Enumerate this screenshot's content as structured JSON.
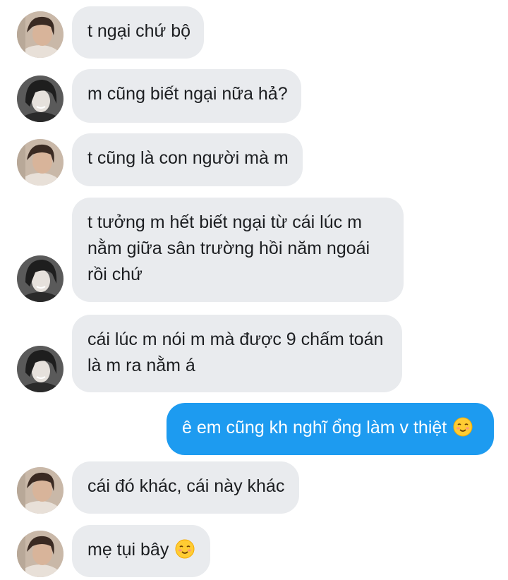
{
  "colors": {
    "received_bubble": "#e9ebee",
    "sent_bubble": "#1d9bf0",
    "received_text": "#1c1e21",
    "sent_text": "#ffffff"
  },
  "messages": [
    {
      "sender": "friend-a",
      "lines": [
        "t ngại chứ bộ"
      ]
    },
    {
      "sender": "friend-b",
      "lines": [
        "m cũng biết ngại nữa hả?"
      ]
    },
    {
      "sender": "friend-a",
      "lines": [
        "t cũng là con người mà m"
      ]
    },
    {
      "sender": "friend-b",
      "lines": [
        "t tưởng m hết biết ngại từ cái lúc m",
        "nằm giữa sân trường hồi năm ngoái",
        "rồi chứ"
      ]
    },
    {
      "sender": "friend-b",
      "lines": [
        "cái lúc m nói m mà được 9 chấm toán",
        "là m ra nằm á"
      ]
    },
    {
      "sender": "me",
      "lines": [
        "ê em cũng kh nghĩ ổng làm v thiệt"
      ],
      "emoji": "smiling-face-emoji"
    },
    {
      "sender": "friend-a",
      "lines": [
        "cái đó khác, cái này khác"
      ]
    },
    {
      "sender": "friend-a",
      "lines": [
        "mẹ tụi bây"
      ],
      "emoji": "smiling-face-emoji"
    }
  ]
}
